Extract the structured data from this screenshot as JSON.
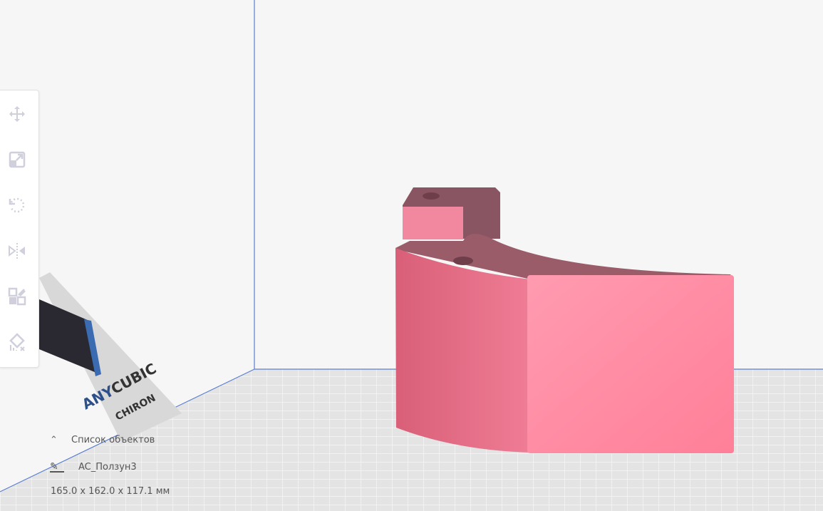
{
  "toolbar": {
    "tools": [
      {
        "name": "move",
        "icon": "move-icon"
      },
      {
        "name": "scale",
        "icon": "scale-icon"
      },
      {
        "name": "rotate",
        "icon": "rotate-icon"
      },
      {
        "name": "mirror",
        "icon": "mirror-icon"
      },
      {
        "name": "per-model-settings",
        "icon": "per-model-settings-icon"
      },
      {
        "name": "support-blocker",
        "icon": "support-blocker-icon"
      }
    ]
  },
  "object_list": {
    "header": "Список объектов",
    "object_name": "AC_Ползун3",
    "dimensions": "165.0 x 162.0 x 117.1 мм"
  },
  "printer_logo": "ANYCUBIC CHIRON",
  "colors": {
    "model": "#f07a92",
    "axis": "#5b7fd0",
    "background": "#f6f6f6",
    "toolbar_icon": "#cfd0dc"
  }
}
